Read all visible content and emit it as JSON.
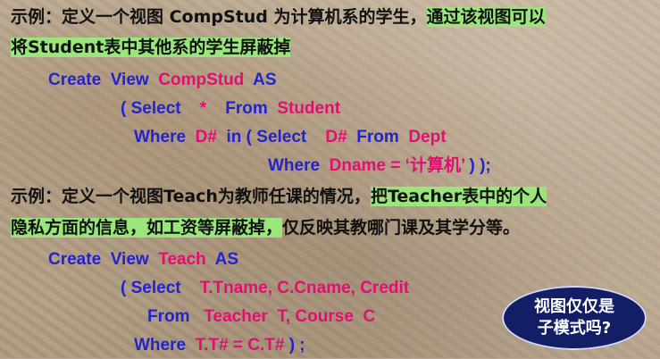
{
  "example1": {
    "line1_plain": "示例：定义一个视图 CompStud 为计算机系的学生，",
    "line1_highlight": "通过该视图可以",
    "line2_highlight": "将Student表中其他系的学生屏蔽掉"
  },
  "code1": {
    "create": "Create",
    "view": "View",
    "name": "CompStud",
    "as": "AS",
    "paren_open": "(",
    "select": "Select",
    "star": "*",
    "from": "From",
    "table": "Student",
    "where": "Where",
    "col": "D#",
    "in": "in",
    "sub_open": "(",
    "sub_select": "Select",
    "sub_col": "D#",
    "sub_from": "From",
    "sub_table": "Dept",
    "sub_where": "Where",
    "sub_cond_name": "Dname",
    "sub_cond_eq": "=",
    "sub_cond_val": "‘计算机’",
    "close": ") );"
  },
  "example2": {
    "line1_plain": "示例：定义一个视图Teach为教师任课的情况，",
    "line1_highlight": "把Teacher表中的个人",
    "line2_highlight_a": "隐私方面的信息，如工资等屏蔽掉，",
    "line2_plain": "仅反映其教哪门课及其学分等。"
  },
  "code2": {
    "create": "Create",
    "view": "View",
    "name": "Teach",
    "as": "AS",
    "paren_open": "(",
    "select": "Select",
    "cols": "T.Tname, C.Cname, Credit",
    "from": "From",
    "tables": "Teacher  T, Course  C",
    "where": "Where",
    "cond": "T.T# = C.T#",
    "close": ") ;"
  },
  "badge": {
    "line1": "视图仅仅是",
    "line2": "子模式吗?"
  },
  "colors": {
    "keyword": "#2323c9",
    "identifier": "#e01070",
    "highlight": "#9be67c",
    "badge_bg": "#141e67"
  }
}
